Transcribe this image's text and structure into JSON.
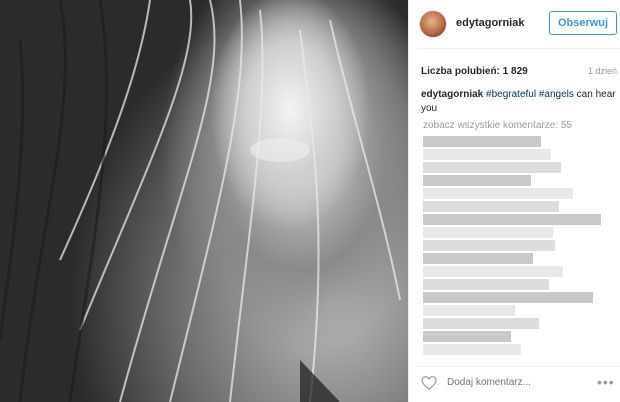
{
  "post": {
    "username": "edytagorniak",
    "follow_label": "Obserwuj",
    "likes_text": "Liczba polubień: 1 829",
    "time_text": "1 dzień",
    "caption": {
      "user": "edytagorniak",
      "tag1": "#begrateful",
      "tag2": "#angels",
      "rest": " can hear you"
    },
    "view_all_comments": "zobacz wszystkie komentarze: 55",
    "add_comment_placeholder": "Dodaj komentarz...",
    "more_label": "•••"
  },
  "icons": {
    "like": "heart-outline-icon",
    "more": "more-options-icon"
  },
  "colors": {
    "accent": "#3897f0",
    "hashtag": "#003569",
    "muted": "#999999"
  }
}
